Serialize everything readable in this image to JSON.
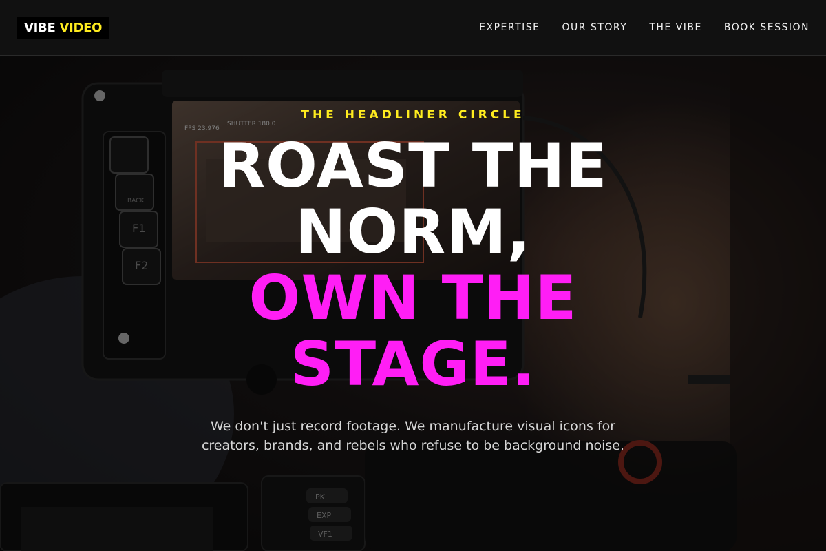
{
  "brand": {
    "word1": "VIBE",
    "word2": "VIDEO"
  },
  "nav": [
    {
      "label": "EXPERTISE"
    },
    {
      "label": "OUR STORY"
    },
    {
      "label": "THE VIBE"
    },
    {
      "label": "BOOK SESSION"
    }
  ],
  "hero": {
    "eyebrow": "THE HEADLINER CIRCLE",
    "headline_line1": "ROAST THE",
    "headline_line2": "NORM,",
    "headline_line3": "OWN THE",
    "headline_line4": "STAGE.",
    "subtitle_line1": "We don't just record footage. We manufacture visual icons for",
    "subtitle_line2": "creators, brands, and rebels who refuse to be background noise.",
    "monitor_fps": "FPS 23.976",
    "monitor_shutter": "SHUTTER 180.0",
    "monitor_buttons": [
      "BACK",
      "F1",
      "F2"
    ],
    "camera_buttons": [
      "PK",
      "EXP",
      "VF1"
    ]
  },
  "colors": {
    "accent_yellow": "#ffec1f",
    "accent_magenta": "#ff1ef5",
    "nav_bg": "#111111"
  }
}
